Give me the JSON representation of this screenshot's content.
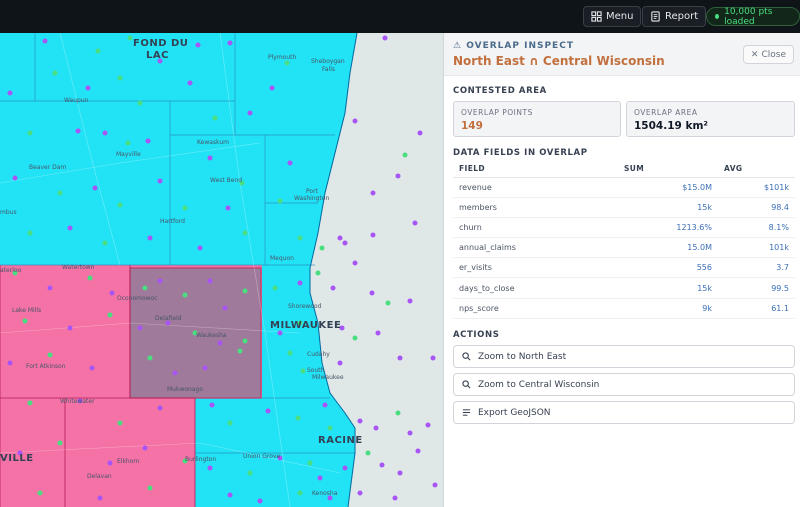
{
  "topbar": {
    "menu_label": "Menu",
    "report_label": "Report",
    "status_text": "10,000 pts loaded"
  },
  "map": {
    "labels": {
      "fond_du_lac": "FOND DU",
      "fond_du_lac_2": "LAC",
      "plymouth": "Plymouth",
      "sheboygan": "Sheboygan",
      "sheboygan_2": "Falls",
      "waupun": "Waupun",
      "kewaskum": "Kewaskum",
      "mayville": "Mayville",
      "beaver_dam": "Beaver Dam",
      "west_bend": "West Bend",
      "port_washington": "Port",
      "port_washington_2": "Washington",
      "hartford": "Hartford",
      "columbus": "mbus",
      "mequon": "Mequon",
      "waterloo": "aterloo",
      "watertown": "Watertown",
      "oconomowoc": "Oconomowoc",
      "lake_mills": "Lake Mills",
      "delafield": "Delafield",
      "waukesha": "Waukesha",
      "shorewood": "Shorewood",
      "milwaukee": "MILWAUKEE",
      "cudahy": "Cudahy",
      "fort_atkinson": "Fort Atkinson",
      "south_milwaukee": "South",
      "south_milwaukee_2": "Milwaukee",
      "mukwonago": "Mukwonago",
      "whitewater": "Whitewater",
      "racine": "RACINE",
      "burlington": "Burlington",
      "union_grove": "Union Grove",
      "elkhorn": "Elkhorn",
      "janesville": "VILLE",
      "delavan": "Delavan",
      "kenosha": "Kenosha"
    },
    "colors": {
      "region_north_east": "#22e3f5",
      "region_south": "#f472a6",
      "overlap": "#a07a9a",
      "point_purple": "#a855f7",
      "point_green": "#4ade80",
      "lake": "#dfe7e7"
    }
  },
  "panel": {
    "kicker": "OVERLAP INSPECT",
    "title": "North East ∩ Central Wisconsin",
    "close_label": "Close",
    "contested_heading": "CONTESTED AREA",
    "overlap_points_label": "OVERLAP POINTS",
    "overlap_points_value": "149",
    "overlap_area_label": "OVERLAP AREA",
    "overlap_area_value": "1504.19 km²",
    "fields_heading": "DATA FIELDS IN OVERLAP",
    "columns": [
      "FIELD",
      "SUM",
      "AVG"
    ],
    "rows": [
      {
        "field": "revenue",
        "sum": "$15.0M",
        "avg": "$101k"
      },
      {
        "field": "members",
        "sum": "15k",
        "avg": "98.4"
      },
      {
        "field": "churn",
        "sum": "1213.6%",
        "avg": "8.1%"
      },
      {
        "field": "annual_claims",
        "sum": "15.0M",
        "avg": "101k"
      },
      {
        "field": "er_visits",
        "sum": "556",
        "avg": "3.7"
      },
      {
        "field": "days_to_close",
        "sum": "15k",
        "avg": "99.5"
      },
      {
        "field": "nps_score",
        "sum": "9k",
        "avg": "61.1"
      }
    ],
    "actions_heading": "ACTIONS",
    "actions": [
      {
        "label": "Zoom to North East",
        "icon": "search-icon"
      },
      {
        "label": "Zoom to Central Wisconsin",
        "icon": "search-icon"
      },
      {
        "label": "Export GeoJSON",
        "icon": "list-icon"
      }
    ]
  }
}
